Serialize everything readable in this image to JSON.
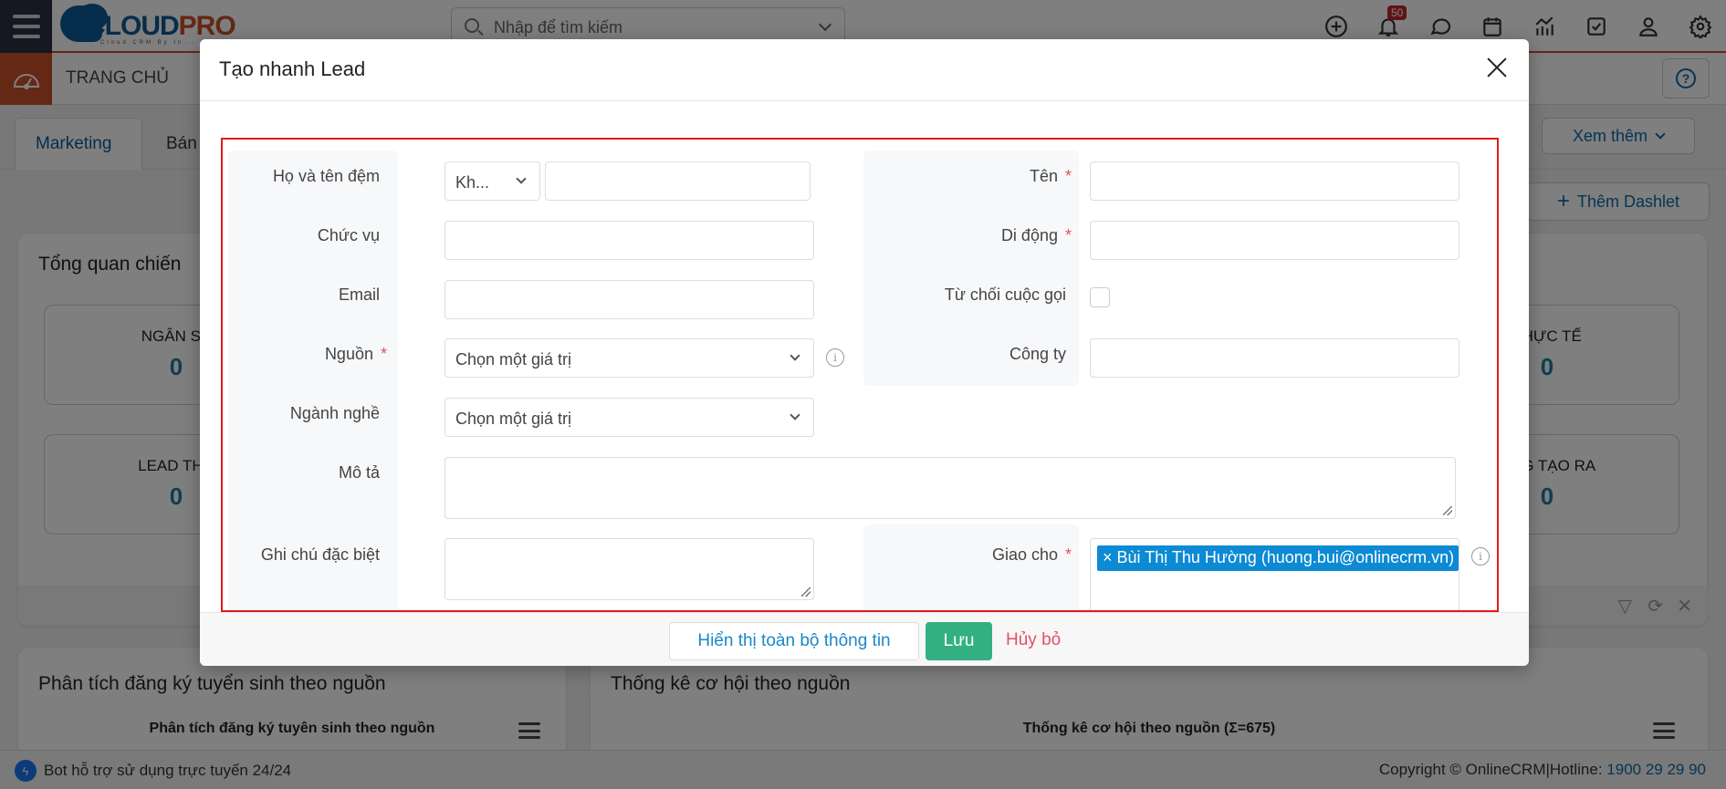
{
  "app": {
    "logo_main": "CLOUD",
    "logo_accent": "PRO",
    "logo_sub": "Cloud CRM By In...",
    "search_placeholder": "Nhập để tìm kiếm",
    "notification_count": "50",
    "page_title": "TRANG CHỦ",
    "brand_color": "#c8502a",
    "accent_color": "#0c5a96"
  },
  "tabs": [
    {
      "label": "Marketing",
      "active": true
    },
    {
      "label": "Bán",
      "active": false
    }
  ],
  "toolbar": {
    "more_label": "Xem thêm",
    "add_dashlet_label": "Thêm Dashlet"
  },
  "dashlet_overview": {
    "title": "Tổng quan chiến",
    "kpis": [
      {
        "label": "NGÂN SÁ",
        "value": "0"
      },
      {
        "label": "THỰC TẾ",
        "value": "0"
      },
      {
        "label": "LEAD THU",
        "value": "0"
      },
      {
        "label": "ỒNG TẠO RA",
        "value": "0"
      }
    ]
  },
  "dashlet_admission": {
    "title": "Phân tích đăng ký tuyển sinh theo nguồn",
    "chart_title": "Phân tích đăng ký tuyên sinh theo nguồn"
  },
  "dashlet_opportunity": {
    "title": "Thống kê cơ hội theo nguồn",
    "chart_title": "Thống kê cơ hội theo nguồn (Σ=675)"
  },
  "footer": {
    "bot_text": "Bot hỗ trợ sử dụng trực tuyến 24/24",
    "copyright": "Copyright © OnlineCRM|Hotline: ",
    "hotline": "1900 29 29 90"
  },
  "modal": {
    "title": "Tạo nhanh Lead",
    "fields": {
      "fullname_label": "Họ và tên đệm",
      "salutation_value": "Kh...",
      "middle_name_value": "",
      "job_title_label": "Chức vụ",
      "job_title_value": "",
      "email_label": "Email",
      "email_value": "",
      "source_label": "Nguồn",
      "source_value": "Chọn một giá trị",
      "industry_label": "Ngành nghề",
      "industry_value": "Chọn một giá trị",
      "description_label": "Mô tả",
      "description_value": "",
      "special_note_label": "Ghi chú đặc biệt",
      "special_note_value": "",
      "first_name_label": "Tên",
      "first_name_value": "",
      "mobile_label": "Di động",
      "mobile_value": "",
      "do_not_call_label": "Từ chối cuộc gọi",
      "do_not_call_checked": false,
      "company_label": "Công ty",
      "company_value": "",
      "assigned_label": "Giao cho",
      "assigned_tag": "× Bùi Thị Thu Hường (huong.bui@onlinecrm.vn)"
    },
    "required_mark": "*",
    "buttons": {
      "show_full": "Hiển thị toàn bộ thông tin",
      "save": "Lưu",
      "cancel": "Hủy bỏ"
    }
  }
}
